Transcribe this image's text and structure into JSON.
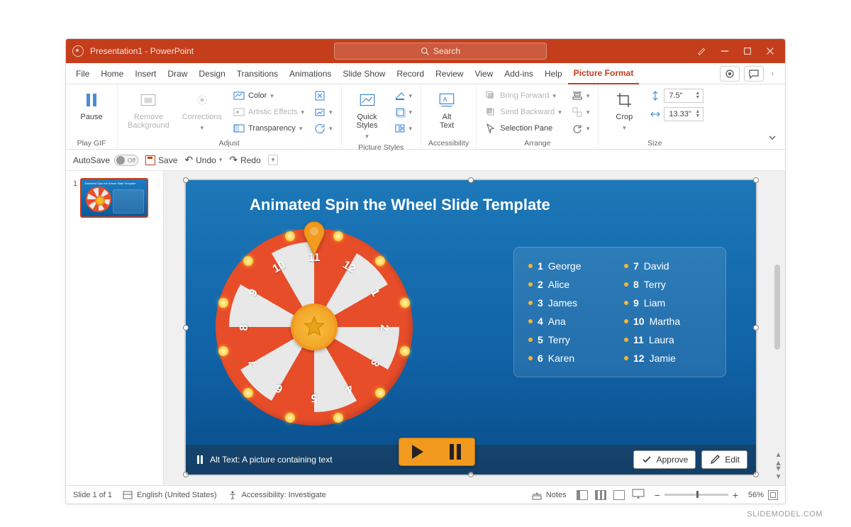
{
  "titlebar": {
    "title": "Presentation1 - PowerPoint",
    "search_placeholder": "Search"
  },
  "tabs": [
    "File",
    "Home",
    "Insert",
    "Draw",
    "Design",
    "Transitions",
    "Animations",
    "Slide Show",
    "Record",
    "Review",
    "View",
    "Add-ins",
    "Help",
    "Picture Format"
  ],
  "active_tab": "Picture Format",
  "ribbon": {
    "play_gif": {
      "pause": "Pause",
      "group": "Play GIF"
    },
    "adjust": {
      "remove_bg": "Remove\nBackground",
      "corrections": "Corrections",
      "color": "Color",
      "artistic": "Artistic Effects",
      "transparency": "Transparency",
      "group": "Adjust"
    },
    "picture_styles": {
      "quick": "Quick\nStyles",
      "group": "Picture Styles"
    },
    "accessibility": {
      "alt": "Alt\nText",
      "group": "Accessibility"
    },
    "arrange": {
      "forward": "Bring Forward",
      "backward": "Send Backward",
      "pane": "Selection Pane",
      "group": "Arrange"
    },
    "size": {
      "crop": "Crop",
      "height": "7.5\"",
      "width": "13.33\"",
      "group": "Size"
    }
  },
  "qat": {
    "autosave": "AutoSave",
    "autosave_state": "Off",
    "save": "Save",
    "undo": "Undo",
    "redo": "Redo"
  },
  "thumbnails": [
    {
      "index": "1"
    }
  ],
  "slide": {
    "title": "Animated Spin the Wheel Slide Template",
    "wheel_numbers": [
      "1",
      "2",
      "3",
      "4",
      "5",
      "6",
      "7",
      "8",
      "9",
      "10",
      "11",
      "12"
    ],
    "names_left": [
      {
        "n": "1",
        "name": "George"
      },
      {
        "n": "2",
        "name": "Alice"
      },
      {
        "n": "3",
        "name": "James"
      },
      {
        "n": "4",
        "name": "Ana"
      },
      {
        "n": "5",
        "name": "Terry"
      },
      {
        "n": "6",
        "name": "Karen"
      }
    ],
    "names_right": [
      {
        "n": "7",
        "name": "David"
      },
      {
        "n": "8",
        "name": "Terry"
      },
      {
        "n": "9",
        "name": "Liam"
      },
      {
        "n": "10",
        "name": "Martha"
      },
      {
        "n": "11",
        "name": "Laura"
      },
      {
        "n": "12",
        "name": "Jamie"
      }
    ],
    "alt_text_label": "Alt Text: A picture containing text",
    "approve": "Approve",
    "edit": "Edit"
  },
  "statusbar": {
    "slide": "Slide 1 of 1",
    "language": "English (United States)",
    "accessibility": "Accessibility: Investigate",
    "notes": "Notes",
    "zoom": "56%"
  },
  "watermark": "SLIDEMODEL.COM"
}
